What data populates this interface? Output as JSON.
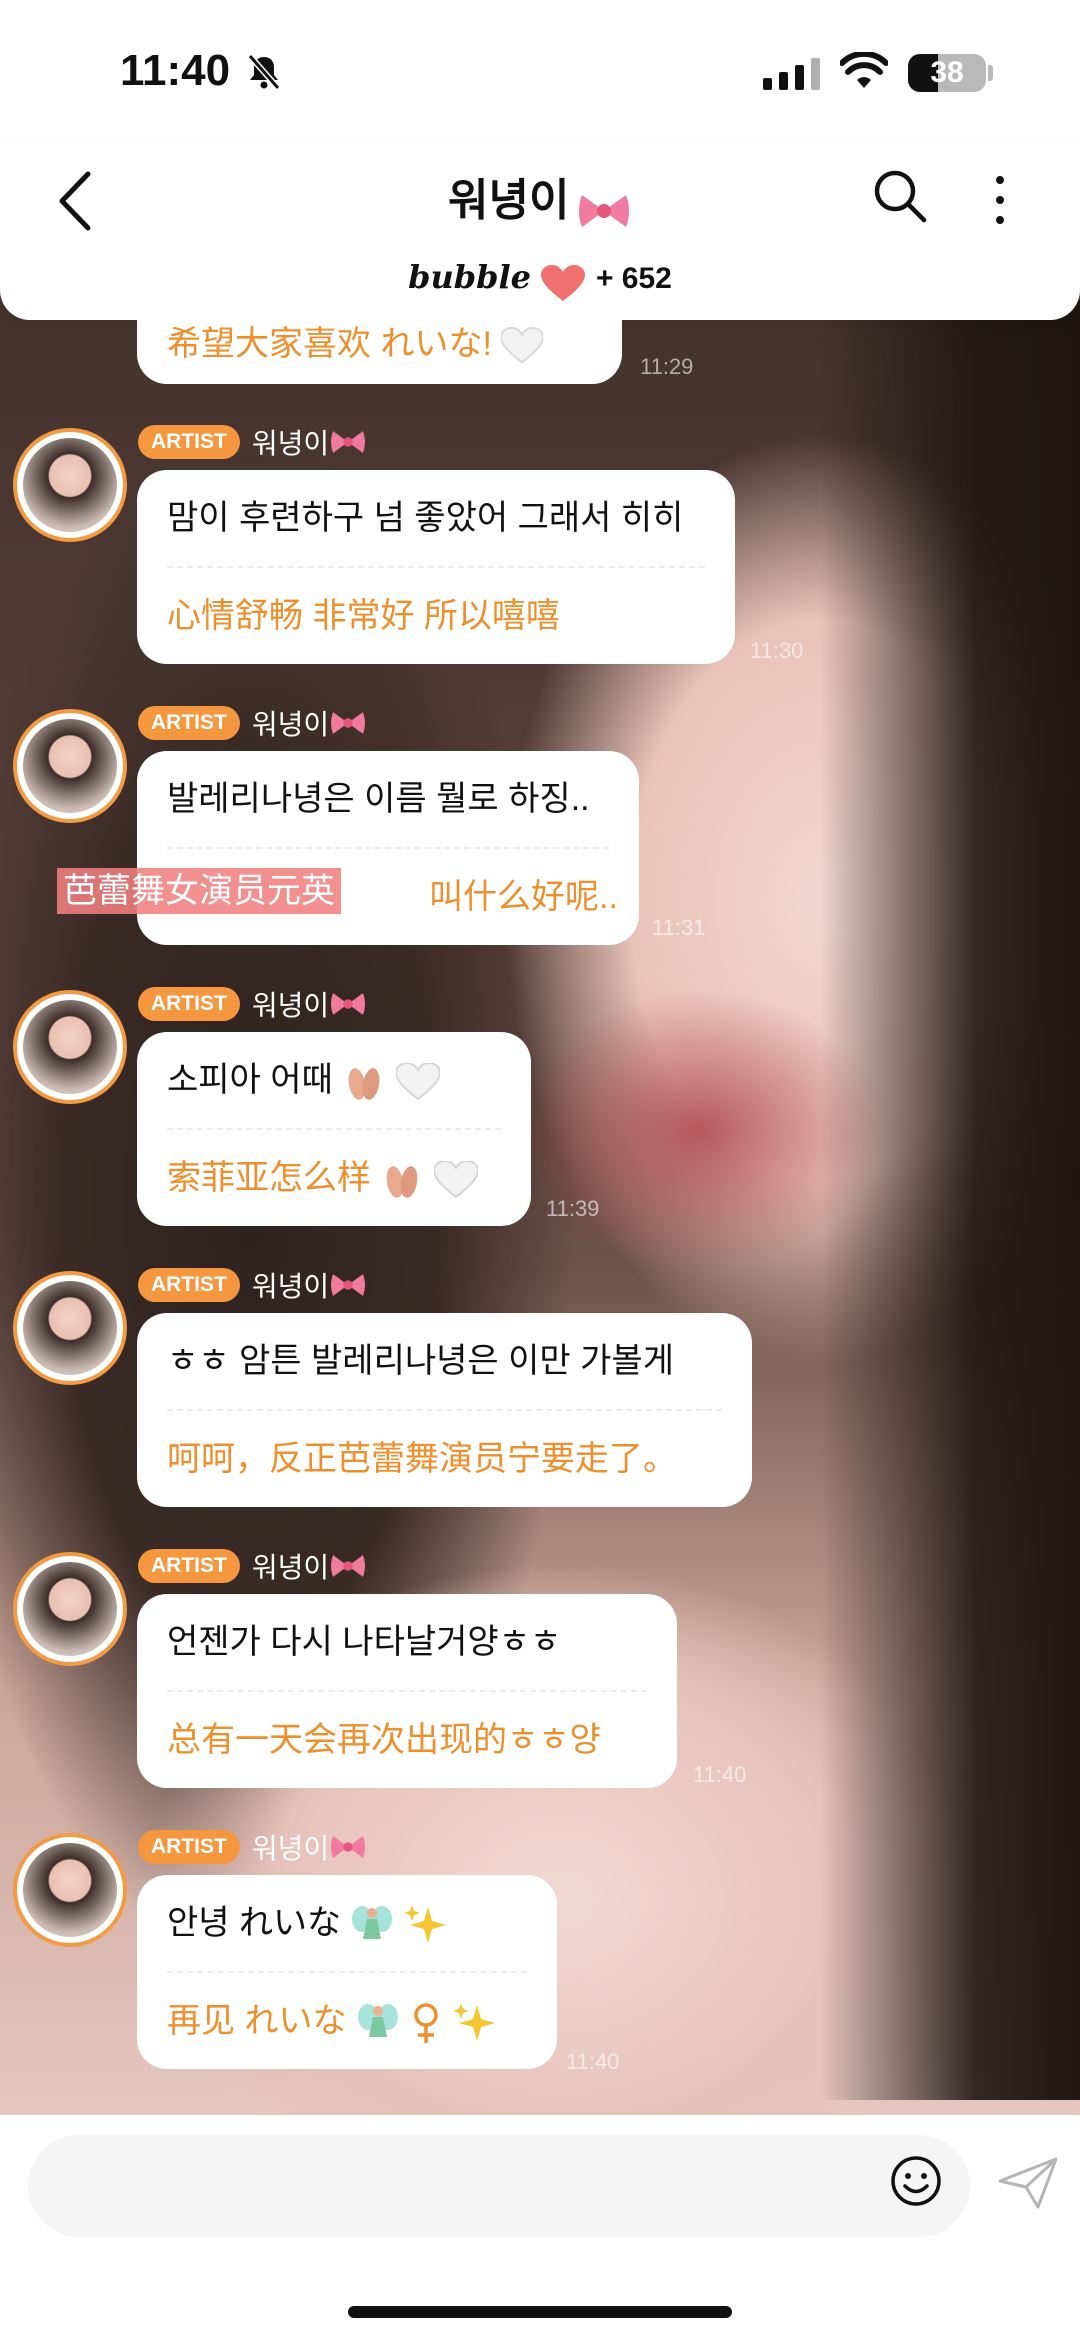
{
  "status_bar": {
    "time": "11:40",
    "battery": "38"
  },
  "header": {
    "title": "워녕이",
    "bubble_logo": "bubble",
    "bubble_count": "+ 652"
  },
  "top_partial": {
    "zh": "希望大家喜欢 れいな!",
    "time": "11:29"
  },
  "overlay_label": "芭蕾舞女演员元英",
  "messages": [
    {
      "badge": "ARTIST",
      "name": "워녕이",
      "ko": "맘이 후련하구 넘 좋았어 그래서 히히",
      "zh": "心情舒畅 非常好 所以嘻嘻",
      "time": "11:30"
    },
    {
      "badge": "ARTIST",
      "name": "워녕이",
      "ko": "발레리나녕은 이름 뭘로 하징..",
      "zh": "叫什么好呢..",
      "time": "11:31"
    },
    {
      "badge": "ARTIST",
      "name": "워녕이",
      "ko": "소피아 어때",
      "zh": "索菲亚怎么样",
      "time": "11:39"
    },
    {
      "badge": "ARTIST",
      "name": "워녕이",
      "ko": "ㅎㅎ 암튼 발레리나녕은 이만 가볼게",
      "zh": "呵呵，反正芭蕾舞演员宁要走了。",
      "time": ""
    },
    {
      "badge": "ARTIST",
      "name": "워녕이",
      "ko": "언젠가 다시 나타날거양ㅎㅎ",
      "zh": "总有一天会再次出现的ㅎㅎ양",
      "time": "11:40"
    },
    {
      "badge": "ARTIST",
      "name": "워녕이",
      "ko": "안녕 れいな",
      "zh": "再见 れいな",
      "time": "11:40"
    }
  ],
  "icons": {
    "bow": "ribbon-bow-icon",
    "heart": "bubble-heart-icon",
    "ballet_shoes": "ballet-shoes-icon",
    "white_heart": "white-heart-icon",
    "fairy": "fairy-icon",
    "sparkles": "sparkles-icon",
    "female_sign": "female-sign-icon"
  },
  "colors": {
    "accent": "#f4973f",
    "translation": "#ee8f2c"
  }
}
